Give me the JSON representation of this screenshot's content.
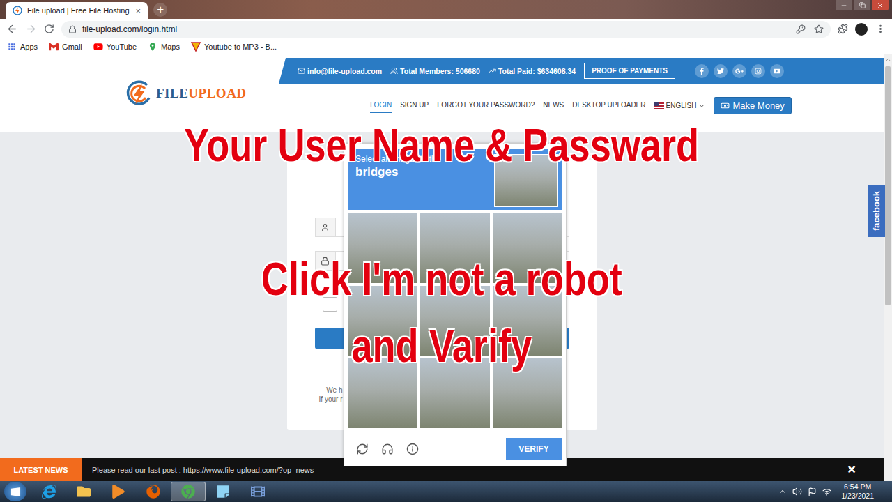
{
  "browser": {
    "tab": {
      "title": "File upload | Free File Hosting",
      "close": "×",
      "selected": true
    },
    "new_tab": "+",
    "forward_disabled": true,
    "url": "file-upload.com/login.html",
    "bookmarks": [
      {
        "label": "Apps",
        "kind": "apps"
      },
      {
        "label": "Gmail",
        "kind": "gmail"
      },
      {
        "label": "YouTube",
        "kind": "youtube"
      },
      {
        "label": "Maps",
        "kind": "maps"
      },
      {
        "label": "Youtube to MP3 - B...",
        "kind": "site"
      }
    ]
  },
  "site": {
    "logo": {
      "first": "FILE",
      "second": "UPLOAD"
    },
    "topbar": {
      "email": "info@file-upload.com",
      "members": "Total Members: 506680",
      "paid": "Total Paid: $634608.34",
      "proof_button": "PROOF OF PAYMENTS"
    },
    "nav": [
      {
        "label": "LOGIN",
        "selected": true
      },
      {
        "label": "SIGN UP",
        "selected": false
      },
      {
        "label": "FORGOT YOUR PASSWORD?",
        "selected": false
      },
      {
        "label": "NEWS",
        "selected": false
      },
      {
        "label": "DESKTOP UPLOADER",
        "selected": false
      }
    ],
    "language": "ENGLISH",
    "make_money": "Make Money",
    "login": {
      "remember_checked": false,
      "notes": [
        "We h",
        "If your r"
      ]
    },
    "facebook_tab": "facebook",
    "news": {
      "label": "LATEST NEWS",
      "text": "Please read our last post : https://www.file-upload.com/?op=news",
      "close": "×"
    },
    "scrollbar": {
      "level": 0.56
    }
  },
  "captcha": {
    "prompt": "Select all images with",
    "target": "bridges",
    "tiles": [
      {
        "selected": false
      },
      {
        "selected": false
      },
      {
        "selected": false
      },
      {
        "selected": false
      },
      {
        "selected": false
      },
      {
        "selected": false
      },
      {
        "selected": false
      },
      {
        "selected": false
      },
      {
        "selected": false
      }
    ],
    "verify": "VERIFY"
  },
  "overlay_text": [
    "Your User Name & Passward",
    "Click I'm not a robot",
    "and Varify"
  ],
  "taskbar": {
    "apps": [
      {
        "kind": "ie",
        "selected": false
      },
      {
        "kind": "folder",
        "selected": false
      },
      {
        "kind": "media",
        "selected": false
      },
      {
        "kind": "firefox",
        "selected": false
      },
      {
        "kind": "chrome",
        "selected": true
      },
      {
        "kind": "notes",
        "selected": false
      },
      {
        "kind": "film",
        "selected": false
      }
    ],
    "time": "6:54 PM",
    "date": "1/23/2021"
  }
}
